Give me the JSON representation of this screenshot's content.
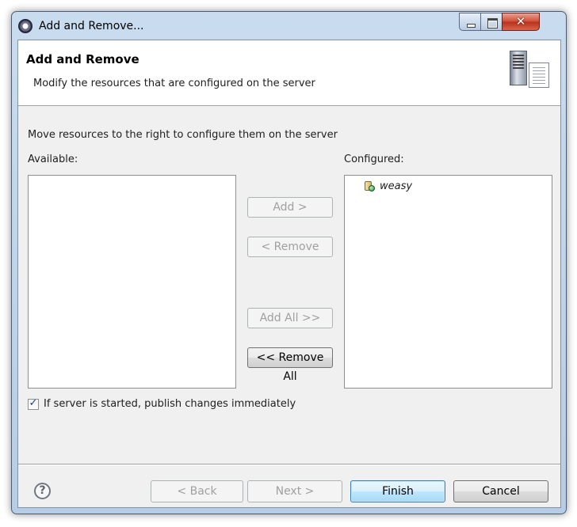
{
  "window": {
    "title": "Add and Remove...",
    "controls": {
      "close_glyph": "✕"
    }
  },
  "banner": {
    "title": "Add and Remove",
    "description": "Modify the resources that are configured on the server",
    "icon": "server-icon"
  },
  "instructions": "Move resources to the right to configure them on the server",
  "available": {
    "label": "Available:",
    "items": []
  },
  "configured": {
    "label": "Configured:",
    "items": [
      {
        "label": "weasy",
        "icon": "web-project-icon"
      }
    ]
  },
  "buttons": {
    "add": "Add >",
    "remove": "< Remove",
    "add_all": "Add All >>",
    "remove_all": "<< Remove All"
  },
  "publish_option": {
    "label": "If server is started, publish changes immediately",
    "checked": true
  },
  "footer": {
    "help_glyph": "?",
    "back": "< Back",
    "next": "Next >",
    "finish": "Finish",
    "cancel": "Cancel"
  }
}
